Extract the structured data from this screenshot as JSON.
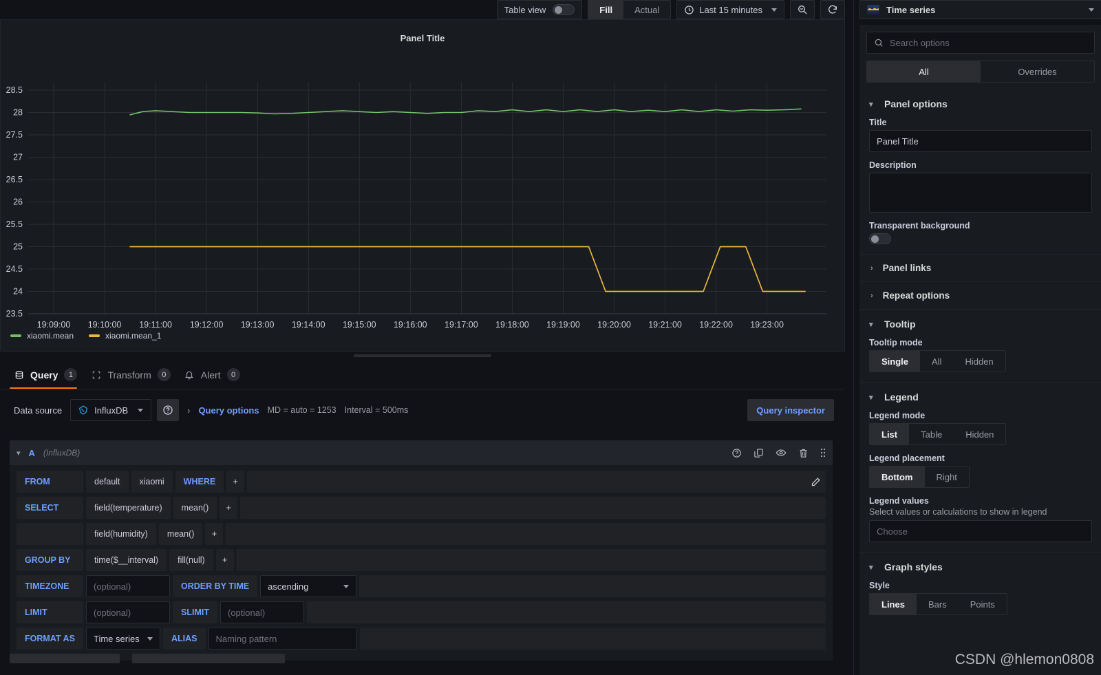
{
  "toolbar": {
    "table_view_label": "Table view",
    "table_view_on": false,
    "fill_label": "Fill",
    "actual_label": "Actual",
    "fill_active": true,
    "time_range": "Last 15 minutes",
    "clock_icon": "clock-icon",
    "zoom_out_icon": "zoom-out-icon",
    "refresh_icon": "refresh-icon"
  },
  "panel": {
    "title": "Panel Title",
    "resize_handle": "panel-resize-handle"
  },
  "chart_data": {
    "type": "line",
    "title": "Panel Title",
    "xlabel": "",
    "ylabel": "",
    "ylim": [
      23.5,
      28.5
    ],
    "ytick_step": 0.5,
    "yticks": [
      "28.5",
      "28",
      "27.5",
      "27",
      "26.5",
      "26",
      "25.5",
      "25",
      "24.5",
      "24",
      "23.5"
    ],
    "xticks": [
      "19:09:00",
      "19:10:00",
      "19:11:00",
      "19:12:00",
      "19:13:00",
      "19:14:00",
      "19:15:00",
      "19:16:00",
      "19:17:00",
      "19:18:00",
      "19:19:00",
      "19:20:00",
      "19:21:00",
      "19:22:00",
      "19:23:00"
    ],
    "grid": true,
    "legend_position": "bottom",
    "series": [
      {
        "name": "xiaomi.mean",
        "color": "#73bf69",
        "x": [
          "19:10:30",
          "19:10:45",
          "19:11:00",
          "19:11:20",
          "19:11:40",
          "19:12:00",
          "19:12:20",
          "19:12:40",
          "19:13:00",
          "19:13:20",
          "19:13:40",
          "19:14:00",
          "19:14:20",
          "19:14:40",
          "19:15:00",
          "19:15:20",
          "19:15:40",
          "19:16:00",
          "19:16:20",
          "19:16:40",
          "19:17:00",
          "19:17:20",
          "19:17:40",
          "19:18:00",
          "19:18:20",
          "19:18:40",
          "19:19:00",
          "19:19:20",
          "19:19:40",
          "19:20:00",
          "19:20:20",
          "19:20:40",
          "19:21:00",
          "19:21:20",
          "19:21:40",
          "19:22:00",
          "19:22:20",
          "19:22:40",
          "19:23:00",
          "19:23:20",
          "19:23:40"
        ],
        "values": [
          27.95,
          28.02,
          28.04,
          28.02,
          28.0,
          28.0,
          28.0,
          28.0,
          27.99,
          27.97,
          27.98,
          28.0,
          28.02,
          28.04,
          28.02,
          28.0,
          28.02,
          28.0,
          27.98,
          28.0,
          28.0,
          28.04,
          28.02,
          28.06,
          28.02,
          28.06,
          28.02,
          28.06,
          28.02,
          28.06,
          28.02,
          28.05,
          28.02,
          28.06,
          28.02,
          28.06,
          28.03,
          28.06,
          28.05,
          28.06,
          28.08
        ]
      },
      {
        "name": "xiaomi.mean_1",
        "color": "#eab839",
        "x": [
          "19:10:30",
          "19:19:30",
          "19:19:50",
          "19:21:45",
          "19:22:05",
          "19:22:35",
          "19:22:55",
          "19:23:45"
        ],
        "values": [
          25,
          25,
          24,
          24,
          25,
          25,
          24,
          24
        ]
      }
    ]
  },
  "editor_tabs": [
    {
      "label": "Query",
      "count": "1",
      "icon": "database-icon",
      "active": true
    },
    {
      "label": "Transform",
      "count": "0",
      "icon": "transform-icon",
      "active": false
    },
    {
      "label": "Alert",
      "count": "0",
      "icon": "bell-icon",
      "active": false
    }
  ],
  "datasource_row": {
    "label": "Data source",
    "value": "InfluxDB",
    "help_icon": "help-circle-icon",
    "query_options_label": "Query options",
    "md_text": "MD = auto = 1253",
    "interval_text": "Interval = 500ms",
    "query_inspector_label": "Query inspector"
  },
  "query": {
    "ref_id": "A",
    "ds_name": "(InfluxDB)",
    "row_icons": [
      "help-circle-icon",
      "duplicate-icon",
      "eye-icon",
      "trash-icon",
      "drag-handle-icon"
    ],
    "edit_icon": "pencil-icon",
    "rows": {
      "from": {
        "keyword": "FROM",
        "policy": "default",
        "measurement": "xiaomi",
        "where": "WHERE",
        "plus": "+"
      },
      "select1": {
        "keyword": "SELECT",
        "field": "field(temperature)",
        "func": "mean()",
        "plus": "+"
      },
      "select2": {
        "keyword": "",
        "field": "field(humidity)",
        "func": "mean()",
        "plus": "+"
      },
      "groupby": {
        "keyword": "GROUP BY",
        "time": "time($__interval)",
        "fill": "fill(null)",
        "plus": "+"
      },
      "timezone": {
        "keyword": "TIMEZONE",
        "placeholder": "(optional)",
        "order_label": "ORDER BY TIME",
        "order_value": "ascending"
      },
      "limit": {
        "keyword": "LIMIT",
        "placeholder": "(optional)",
        "slimit_label": "SLIMIT",
        "slimit_placeholder": "(optional)"
      },
      "format": {
        "keyword": "FORMAT AS",
        "value": "Time series",
        "alias_label": "ALIAS",
        "alias_placeholder": "Naming pattern"
      }
    }
  },
  "options": {
    "viz_name": "Time series",
    "viz_icon": "timeseries-icon",
    "search_placeholder": "Search options",
    "search_icon": "search-icon",
    "tabs": [
      {
        "label": "All",
        "active": true
      },
      {
        "label": "Overrides",
        "active": false
      }
    ],
    "panel_options": {
      "heading": "Panel options",
      "title_label": "Title",
      "title_value": "Panel Title",
      "description_label": "Description",
      "description_value": "",
      "transparent_label": "Transparent background",
      "transparent_on": false,
      "panel_links_label": "Panel links",
      "repeat_options_label": "Repeat options"
    },
    "tooltip": {
      "heading": "Tooltip",
      "mode_label": "Tooltip mode",
      "modes": [
        {
          "label": "Single",
          "active": true
        },
        {
          "label": "All",
          "active": false
        },
        {
          "label": "Hidden",
          "active": false
        }
      ]
    },
    "legend": {
      "heading": "Legend",
      "mode_label": "Legend mode",
      "modes": [
        {
          "label": "List",
          "active": true
        },
        {
          "label": "Table",
          "active": false
        },
        {
          "label": "Hidden",
          "active": false
        }
      ],
      "placement_label": "Legend placement",
      "placements": [
        {
          "label": "Bottom",
          "active": true
        },
        {
          "label": "Right",
          "active": false
        }
      ],
      "values_label": "Legend values",
      "values_desc": "Select values or calculations to show in legend",
      "values_placeholder": "Choose"
    },
    "graph_styles": {
      "heading": "Graph styles",
      "style_label": "Style",
      "styles": [
        {
          "label": "Lines",
          "active": true
        },
        {
          "label": "Bars",
          "active": false
        },
        {
          "label": "Points",
          "active": false
        }
      ]
    }
  },
  "watermark": "CSDN @hlemon0808"
}
